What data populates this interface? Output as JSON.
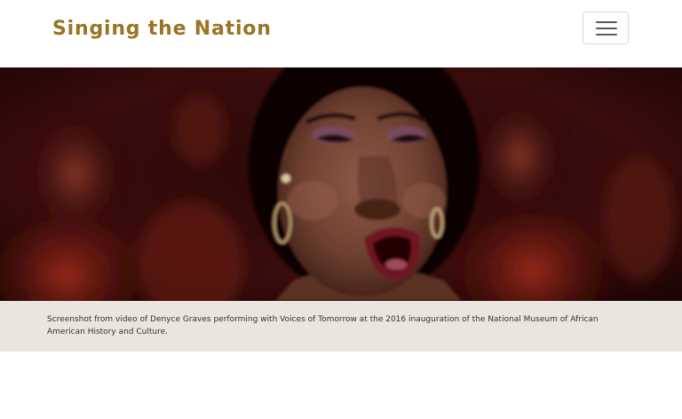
{
  "site": {
    "title": "Singing the Nation",
    "menu_icon": "hamburger-menu-icon",
    "brand_color": "#9a7424"
  },
  "hero": {
    "image_label": "Denyce Graves performing"
  },
  "caption": {
    "text": "Screenshot from video of Denyce Graves performing with Voices of Tomorrow at the 2016 inauguration of the National Museum of African American History and Culture."
  }
}
